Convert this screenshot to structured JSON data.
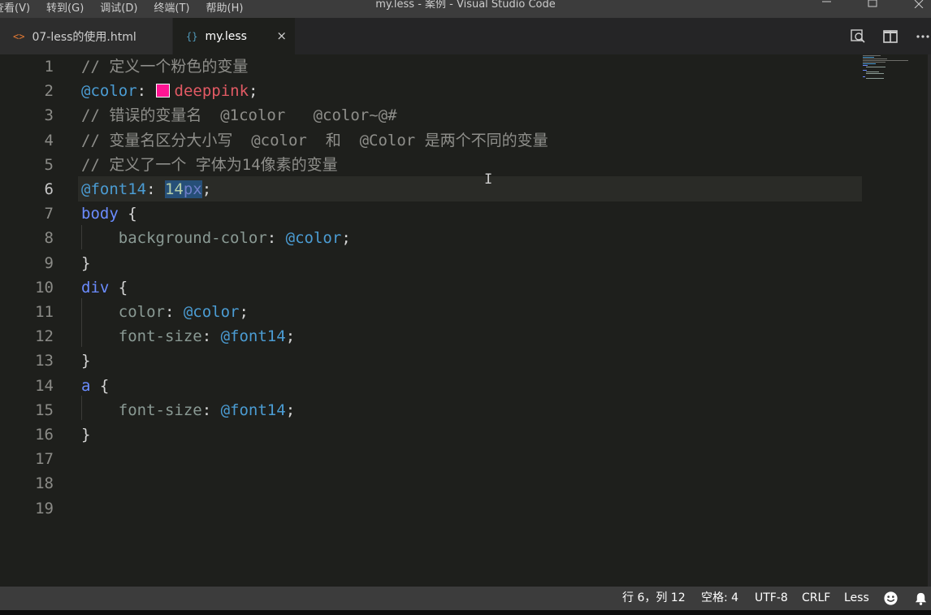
{
  "window": {
    "title": "my.less - 案例 - Visual Studio Code",
    "menu": [
      "查看(V)",
      "转到(G)",
      "调试(D)",
      "终端(T)",
      "帮助(H)"
    ]
  },
  "tabs": [
    {
      "icon": "<>",
      "label": "07-less的使用.html",
      "active": false
    },
    {
      "icon": "{}",
      "label": "my.less",
      "active": true,
      "close": "×"
    }
  ],
  "editor": {
    "line_numbers": [
      "1",
      "2",
      "3",
      "4",
      "5",
      "6",
      "7",
      "8",
      "9",
      "10",
      "11",
      "12",
      "13",
      "14",
      "15",
      "16",
      "17",
      "18",
      "19"
    ],
    "current_line": 6,
    "lines": [
      [
        {
          "t": "// 定义一个粉色的变量",
          "c": "comment"
        }
      ],
      [
        {
          "t": "@color",
          "c": "var"
        },
        {
          "t": ": ",
          "c": "punct"
        },
        {
          "swatch": true
        },
        {
          "t": "deeppink",
          "c": "string"
        },
        {
          "t": ";",
          "c": "punct"
        }
      ],
      [
        {
          "t": "// 错误的变量名  @1color   @color~@#",
          "c": "comment"
        }
      ],
      [
        {
          "t": "// 变量名区分大小写  @color  和  @Color 是两个不同的变量",
          "c": "comment"
        }
      ],
      [
        {
          "t": "// 定义了一个 字体为14像素的变量",
          "c": "comment"
        }
      ],
      [
        {
          "t": "@font14",
          "c": "var"
        },
        {
          "t": ": ",
          "c": "punct"
        },
        {
          "t": "14",
          "c": "num",
          "sel": true
        },
        {
          "t": "px",
          "c": "unit",
          "sel": true
        },
        {
          "t": ";",
          "c": "punct"
        }
      ],
      [
        {
          "t": "body",
          "c": "sel"
        },
        {
          "t": " {",
          "c": "punct"
        }
      ],
      [
        {
          "t": "    background-color",
          "c": "prop"
        },
        {
          "t": ": ",
          "c": "punct"
        },
        {
          "t": "@color",
          "c": "var"
        },
        {
          "t": ";",
          "c": "punct"
        }
      ],
      [
        {
          "t": "}",
          "c": "punct"
        }
      ],
      [
        {
          "t": "div",
          "c": "sel"
        },
        {
          "t": " {",
          "c": "punct"
        }
      ],
      [
        {
          "t": "    color",
          "c": "prop"
        },
        {
          "t": ": ",
          "c": "punct"
        },
        {
          "t": "@color",
          "c": "var"
        },
        {
          "t": ";",
          "c": "punct"
        }
      ],
      [
        {
          "t": "    font-size",
          "c": "prop"
        },
        {
          "t": ": ",
          "c": "punct"
        },
        {
          "t": "@font14",
          "c": "var"
        },
        {
          "t": ";",
          "c": "punct"
        }
      ],
      [
        {
          "t": "}",
          "c": "punct"
        }
      ],
      [
        {
          "t": "a",
          "c": "sel"
        },
        {
          "t": " {",
          "c": "punct"
        }
      ],
      [
        {
          "t": "    font-size",
          "c": "prop"
        },
        {
          "t": ": ",
          "c": "punct"
        },
        {
          "t": "@font14",
          "c": "var"
        },
        {
          "t": ";",
          "c": "punct"
        }
      ],
      [
        {
          "t": "}",
          "c": "punct"
        }
      ],
      [],
      [],
      []
    ]
  },
  "statusbar": {
    "position": "行 6，列 12",
    "indent": "空格: 4",
    "encoding": "UTF-8",
    "eol": "CRLF",
    "language": "Less"
  },
  "icons": {
    "tab_actions": [
      "open-changes-icon",
      "split-editor-icon",
      "more-actions-icon"
    ],
    "status": [
      "feedback-smiley-icon",
      "notifications-bell-icon"
    ]
  },
  "colors": {
    "swatch": "#ff1493",
    "variable": "#4b9cd3",
    "string": "#e25a64",
    "comment": "#8e8e8a"
  }
}
